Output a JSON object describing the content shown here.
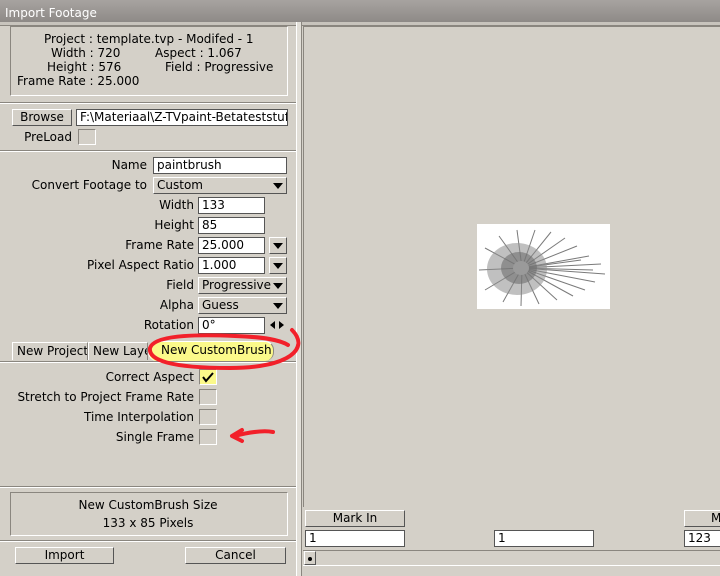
{
  "window": {
    "title": "Import Footage"
  },
  "info": {
    "project": "Project : template.tvp - Modifed -  1",
    "width": "Width : 720",
    "aspect": "Aspect : 1.067",
    "height": "Height : 576",
    "field": "Field : Progressive",
    "frame_rate": "Frame Rate : 25.000"
  },
  "file": {
    "browse_label": "Browse",
    "path": "F:\\Materiaal\\Z-TVpaint-Betateststuff\\Cu",
    "preload_label": "PreLoad"
  },
  "form": {
    "name_label": "Name",
    "name_value": "paintbrush",
    "convert_label": "Convert Footage to",
    "convert_value": "Custom",
    "width_label": "Width",
    "width_value": "133",
    "height_label": "Height",
    "height_value": "85",
    "frame_rate_label": "Frame Rate",
    "frame_rate_value": "25.000",
    "pixel_aspect_label": "Pixel Aspect Ratio",
    "pixel_aspect_value": "1.000",
    "field_label": "Field",
    "field_value": "Progressive",
    "alpha_label": "Alpha",
    "alpha_value": "Guess",
    "rotation_label": "Rotation",
    "rotation_value": "0°"
  },
  "tabs": [
    {
      "label": "New Project"
    },
    {
      "label": "New Layer"
    },
    {
      "label": "New CustomBrush"
    }
  ],
  "options": {
    "correct_aspect_label": "Correct Aspect",
    "stretch_label": "Stretch to Project Frame Rate",
    "time_interp_label": "Time Interpolation",
    "single_frame_label": "Single Frame"
  },
  "size_box": {
    "title": "New CustomBrush Size",
    "value": "133 x 85 Pixels"
  },
  "buttons": {
    "import": "Import",
    "cancel": "Cancel"
  },
  "marks": {
    "mark_in_label": "Mark In",
    "mark_out_label": "M",
    "in_value": "1",
    "mid_value": "1",
    "out_value": "123"
  },
  "colors": {
    "highlight": "#fbf98a",
    "annotation": "#f2202a"
  }
}
